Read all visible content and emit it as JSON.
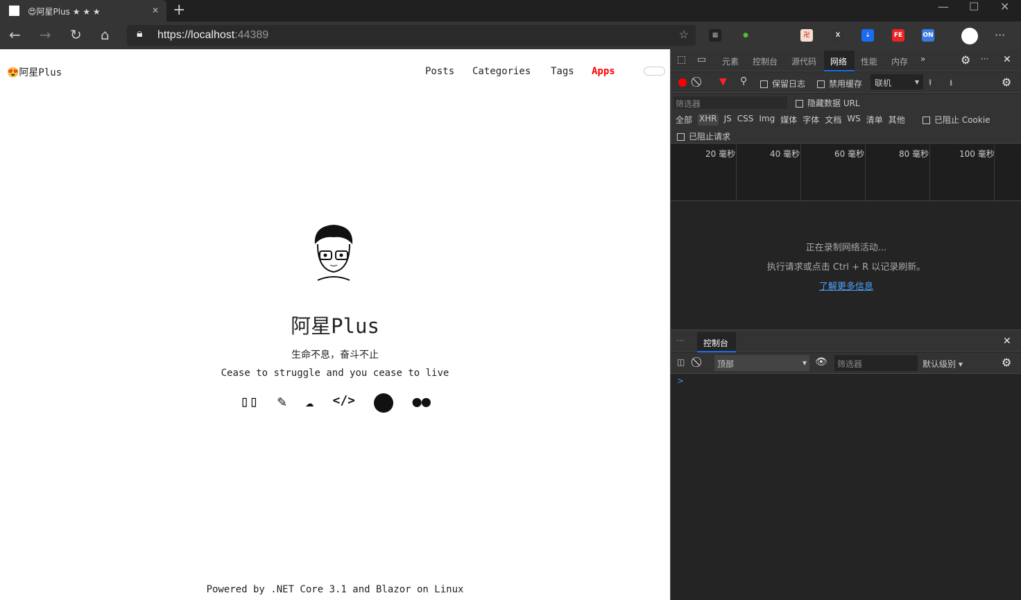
{
  "browser": {
    "tab_title": "😍阿星Plus ★ ★ ★",
    "url_scheme": "https://",
    "url_host": "localhost",
    "url_port": ":44389",
    "new_tab": "+",
    "close_tab": "✕",
    "more": "···"
  },
  "site": {
    "logo": "😍阿星Plus",
    "nav": [
      {
        "label": "Posts"
      },
      {
        "label": "Categories"
      },
      {
        "label": "Tags"
      },
      {
        "label": "Apps",
        "active": true
      }
    ],
    "name": "阿星Plus",
    "motto_cn": "生命不息，奋斗不止",
    "motto_en": "Cease to struggle and you cease to live",
    "links": [
      "book-icon",
      "notebook-icon",
      "cloud-api-icon",
      "code-icon",
      "github-icon",
      "wechat-icon"
    ],
    "footer": "Powered by .NET Core 3.1 and Blazor on Linux",
    "accent": "#ff0000"
  },
  "devtools": {
    "tabs": [
      "元素",
      "控制台",
      "源代码",
      "网络",
      "性能",
      "内存"
    ],
    "active_tab": "网络",
    "preserve_log": "保留日志",
    "disable_cache": "禁用缓存",
    "throttle": "联机",
    "filter_placeholder": "筛选器",
    "hide_data_urls": "隐藏数据 URL",
    "types": [
      "全部",
      "XHR",
      "JS",
      "CSS",
      "Img",
      "媒体",
      "字体",
      "文档",
      "WS",
      "清单",
      "其他"
    ],
    "active_type": "XHR",
    "blocked_cookies": "已阻止 Cookie",
    "blocked_requests": "已阻止请求",
    "timeline": [
      "20 毫秒",
      "40 毫秒",
      "60 毫秒",
      "80 毫秒",
      "100 毫秒"
    ],
    "msg1": "正在录制网络活动...",
    "msg2": "执行请求或点击 Ctrl + R 以记录刷新。",
    "learn_more": "了解更多信息",
    "drawer_tab": "控制台",
    "context": "顶部",
    "console_filter": "筛选器",
    "levels": "默认级别 ▾",
    "prompt": ">"
  }
}
